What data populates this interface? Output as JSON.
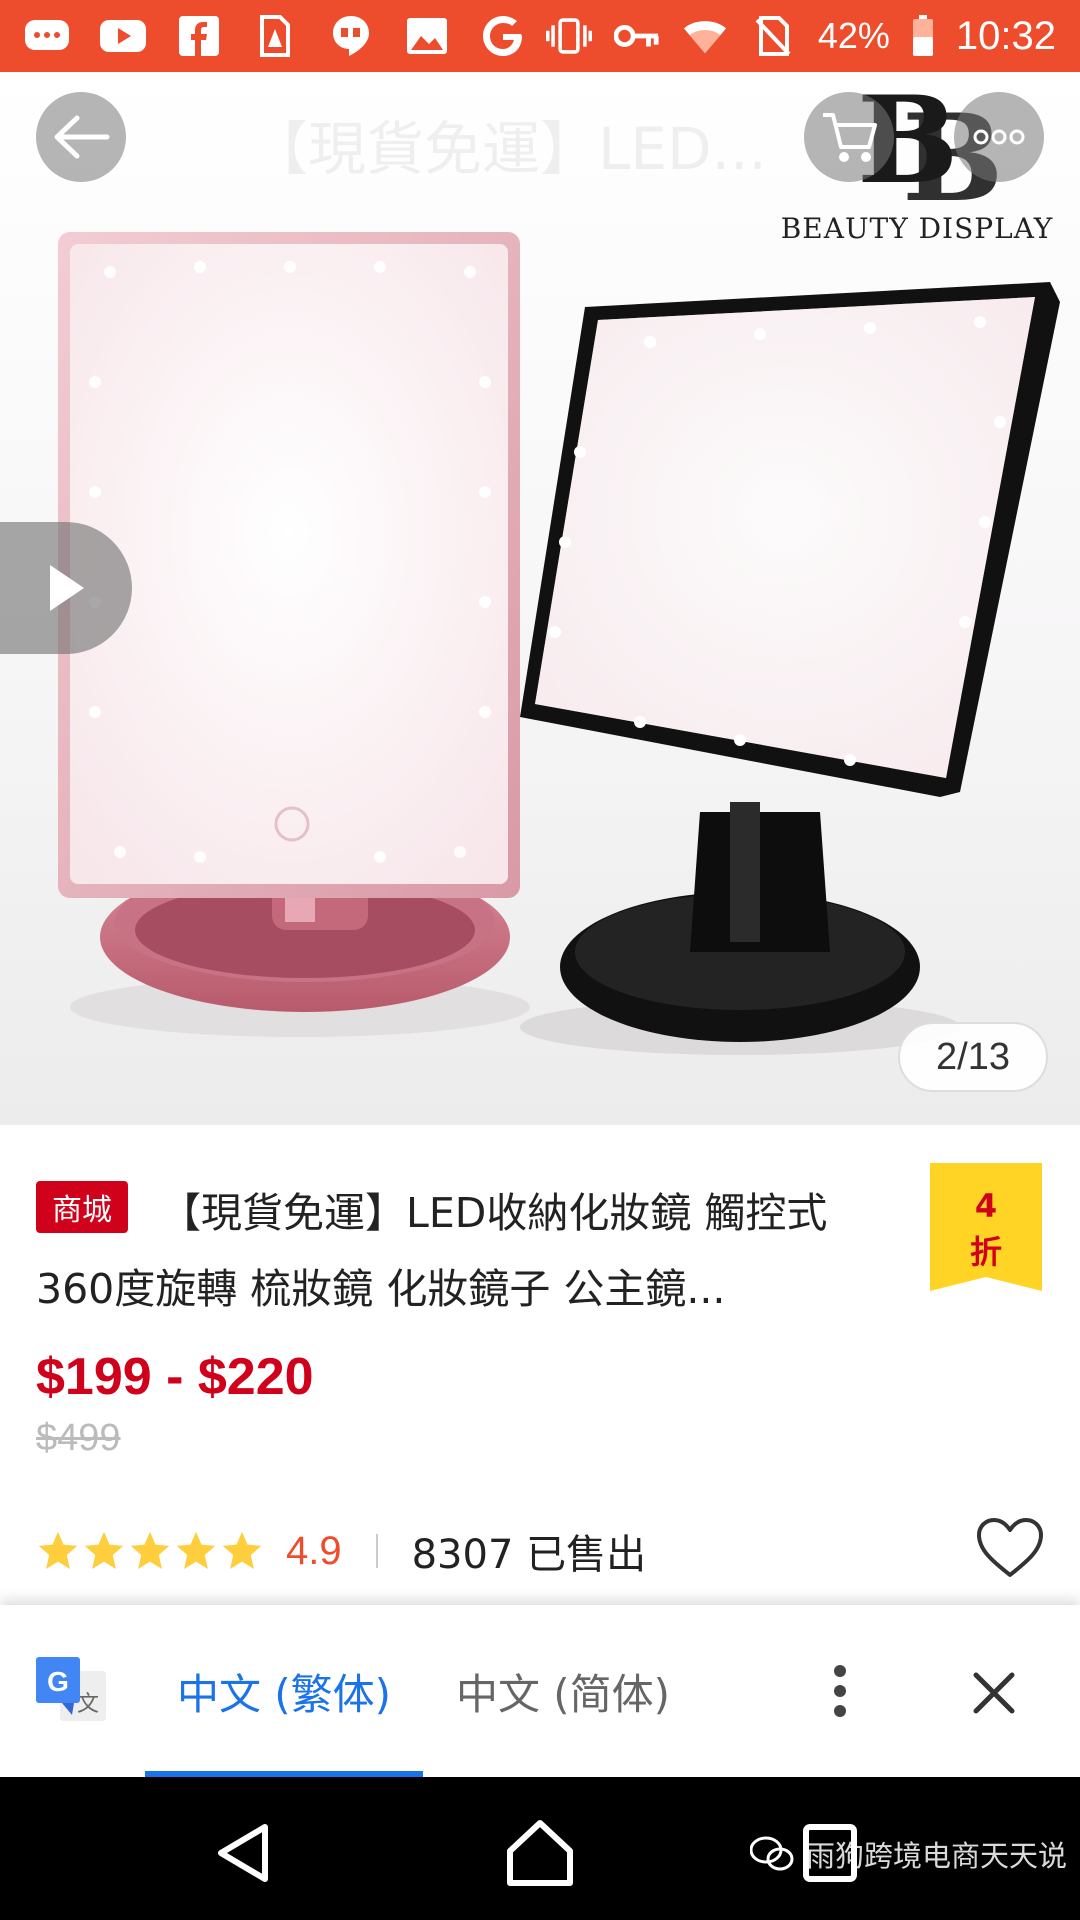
{
  "status_bar": {
    "left_icons": [
      "message-icon",
      "youtube-icon",
      "facebook-icon",
      "sim-alert-icon",
      "hangouts-icon",
      "gallery-icon",
      "google-icon"
    ],
    "right_icons": [
      "vibrate-icon",
      "vpn-key-icon",
      "wifi-icon",
      "no-sim-icon"
    ],
    "battery": "42%",
    "time": "10:32",
    "color": "#ee4d2d"
  },
  "header": {
    "title": "【現貨免運】LED..."
  },
  "product_image": {
    "brand_text": "BEAUTY DISPLAY",
    "counter": "2/13"
  },
  "product": {
    "mall_badge": "商城",
    "title": "【現貨免運】LED收納化妝鏡 觸控式 360度旋轉 梳妝鏡 化妝鏡子 公主鏡...",
    "discount": {
      "line1": "4",
      "line2": "折"
    },
    "price": "$199 - $220",
    "original_price": "$499",
    "rating": 4.9,
    "rating_text": "4.9",
    "stars": 5,
    "sold": "8307 已售出",
    "accent": "#d0011b"
  },
  "translate_bar": {
    "tabs": [
      {
        "label": "中文 (繁体)",
        "active": true
      },
      {
        "label": "中文 (简体)",
        "active": false
      }
    ],
    "accent": "#1a73e8"
  },
  "nav_bar": {
    "watermark": "雨狗跨境电商天天说"
  }
}
